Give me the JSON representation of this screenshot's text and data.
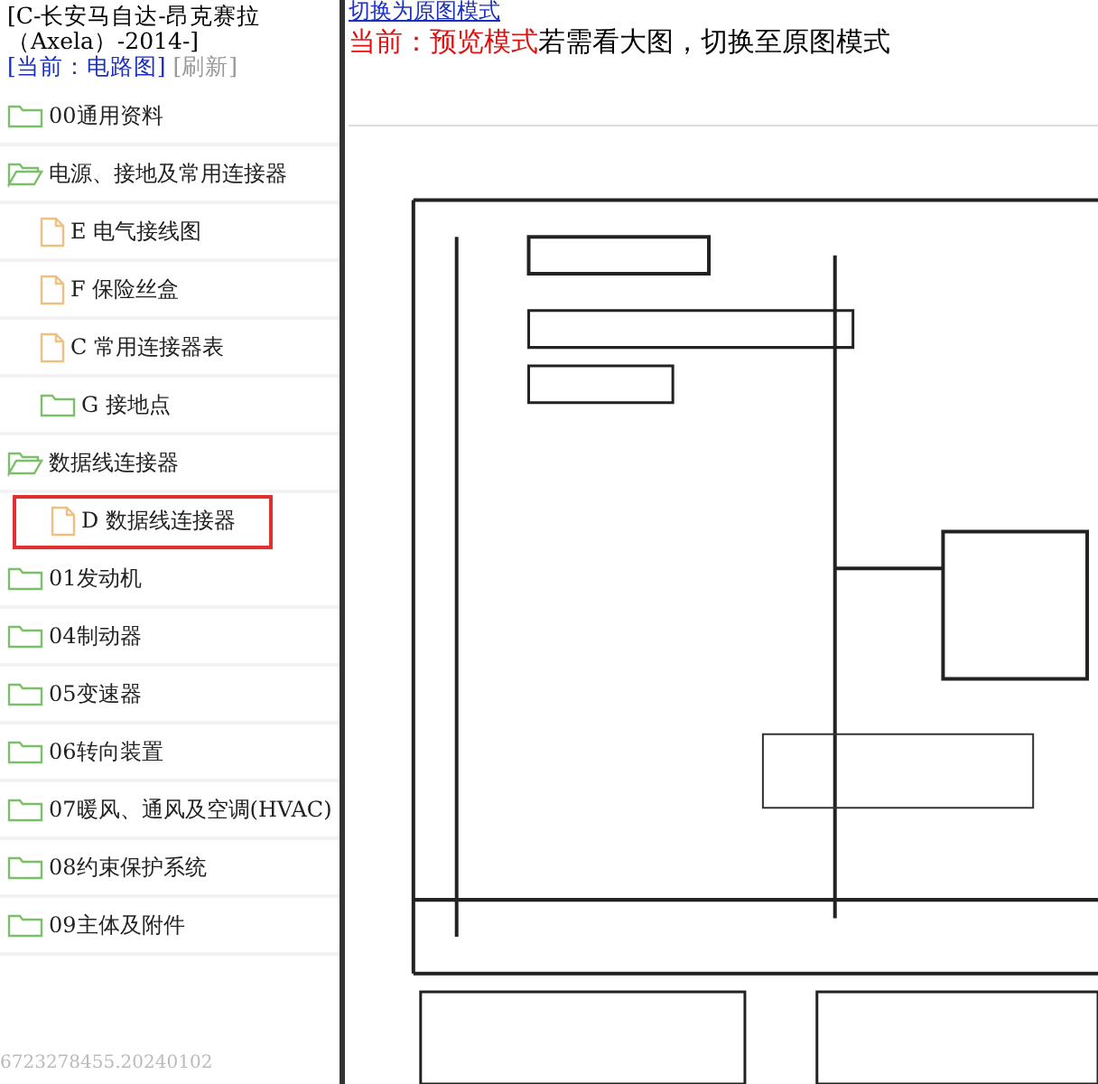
{
  "header": {
    "title": "[C-长安马自达-昂克赛拉（Axela）-2014-]",
    "current": "[当前：电路图]",
    "refresh": "[刷新]"
  },
  "tree": [
    {
      "kind": "folder",
      "label": "00通用资料",
      "expanded": false,
      "selected": false
    },
    {
      "kind": "folder",
      "label": "电源、接地及常用连接器",
      "expanded": true,
      "selected": false,
      "children": [
        {
          "kind": "file",
          "label": "E 电气接线图",
          "selected": false
        },
        {
          "kind": "file",
          "label": "F 保险丝盒",
          "selected": false
        },
        {
          "kind": "file",
          "label": "C 常用连接器表",
          "selected": false
        },
        {
          "kind": "folder",
          "label": "G 接地点",
          "expanded": false,
          "selected": false
        }
      ]
    },
    {
      "kind": "folder",
      "label": "数据线连接器",
      "expanded": true,
      "selected": false,
      "children": [
        {
          "kind": "file",
          "label": "D 数据线连接器",
          "selected": true
        }
      ]
    },
    {
      "kind": "folder",
      "label": "01发动机",
      "expanded": false,
      "selected": false
    },
    {
      "kind": "folder",
      "label": "04制动器",
      "expanded": false,
      "selected": false
    },
    {
      "kind": "folder",
      "label": "05变速器",
      "expanded": false,
      "selected": false
    },
    {
      "kind": "folder",
      "label": "06转向装置",
      "expanded": false,
      "selected": false
    },
    {
      "kind": "folder",
      "label": "07暖风、通风及空调(HVAC)",
      "expanded": false,
      "selected": false
    },
    {
      "kind": "folder",
      "label": "08约束保护系统",
      "expanded": false,
      "selected": false
    },
    {
      "kind": "folder",
      "label": "09主体及附件",
      "expanded": false,
      "selected": false
    }
  ],
  "footer": "6723278455.20240102",
  "viewer": {
    "switch_link": "切换为原图模式",
    "mode_label": "当前：预览模式",
    "mode_hint": "若需看大图，切换至原图模式"
  }
}
